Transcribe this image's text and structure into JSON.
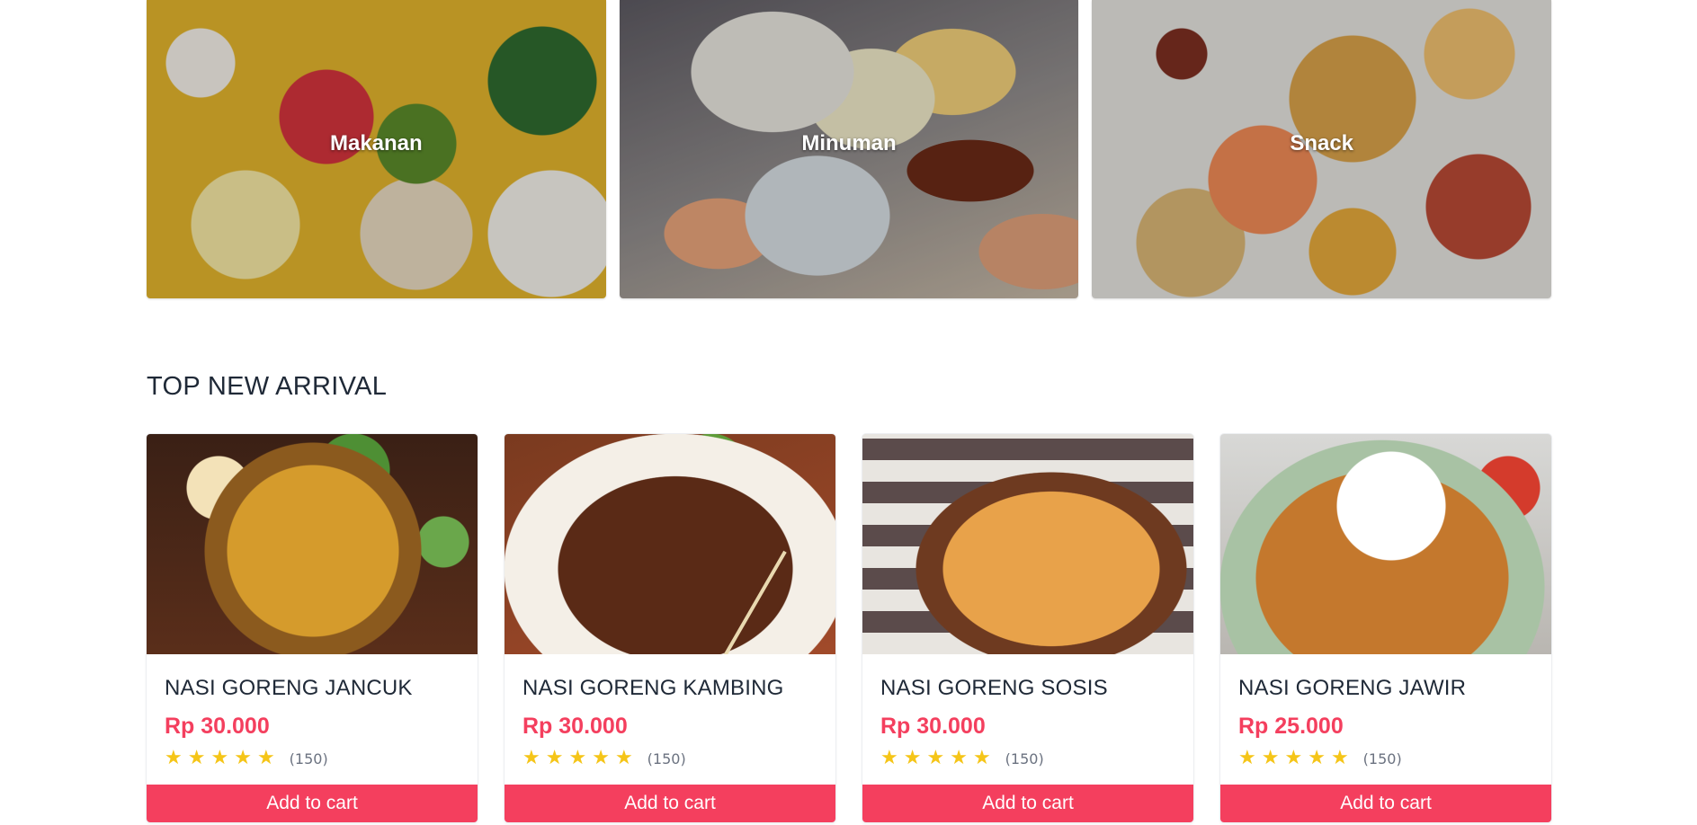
{
  "categories": [
    {
      "label": "Makanan"
    },
    {
      "label": "Minuman"
    },
    {
      "label": "Snack"
    }
  ],
  "section": {
    "title": "TOP NEW ARRIVAL"
  },
  "products": [
    {
      "name": "NASI GORENG JANCUK",
      "price": "Rp 30.000",
      "rating": 5,
      "reviews": "(150)",
      "cta": "Add to cart"
    },
    {
      "name": "NASI GORENG KAMBING",
      "price": "Rp 30.000",
      "rating": 5,
      "reviews": "(150)",
      "cta": "Add to cart"
    },
    {
      "name": "NASI GORENG SOSIS",
      "price": "Rp 30.000",
      "rating": 5,
      "reviews": "(150)",
      "cta": "Add to cart"
    },
    {
      "name": "NASI GORENG JAWIR",
      "price": "Rp 25.000",
      "rating": 5,
      "reviews": "(150)",
      "cta": "Add to cart"
    }
  ],
  "colors": {
    "accent": "#f43f5e",
    "star": "#f5c518",
    "text": "#1f2937"
  },
  "icons": {
    "rating": "star-icon"
  }
}
